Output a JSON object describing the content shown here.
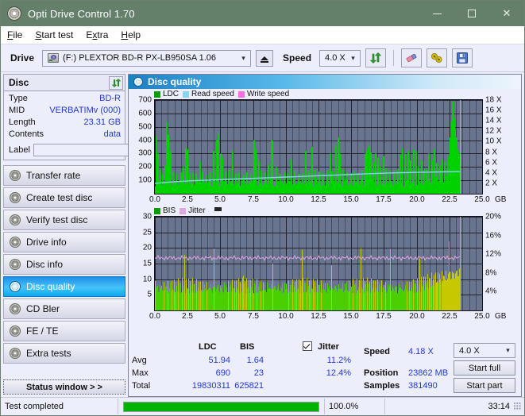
{
  "window": {
    "title": "Opti Drive Control 1.70",
    "icon": "disc-icon",
    "minimize": "minimize-icon",
    "maximize": "maximize-icon",
    "close": "close-icon"
  },
  "menu": [
    {
      "label": "File",
      "accel": "F"
    },
    {
      "label": "Start test",
      "accel": "S"
    },
    {
      "label": "Extra",
      "accel": "x"
    },
    {
      "label": "Help",
      "accel": "H"
    }
  ],
  "toolbar": {
    "drive_label": "Drive",
    "drive_value": "(F:)  PLEXTOR BD-R  PX-LB950SA 1.06",
    "eject": "eject-icon",
    "speed_label": "Speed",
    "speed_value": "4.0 X",
    "refresh": "refresh-icon",
    "eraser": "eraser-icon",
    "tools": "tools-icon",
    "save": "save-icon"
  },
  "disc": {
    "header": "Disc",
    "refresh": "refresh-icon",
    "rows": [
      {
        "key": "Type",
        "value": "BD-R"
      },
      {
        "key": "MID",
        "value": "VERBATIMv (000)"
      },
      {
        "key": "Length",
        "value": "23.31 GB"
      },
      {
        "key": "Contents",
        "value": "data"
      }
    ],
    "label_key": "Label",
    "label_value": "",
    "label_placeholder": "",
    "label_button": "disc-icon"
  },
  "sidebar": {
    "items": [
      {
        "label": "Transfer rate",
        "active": false
      },
      {
        "label": "Create test disc",
        "active": false
      },
      {
        "label": "Verify test disc",
        "active": false
      },
      {
        "label": "Drive info",
        "active": false
      },
      {
        "label": "Disc info",
        "active": false
      },
      {
        "label": "Disc quality",
        "active": true
      },
      {
        "label": "CD Bler",
        "active": false
      },
      {
        "label": "FE / TE",
        "active": false
      },
      {
        "label": "Extra tests",
        "active": false
      }
    ],
    "status_button": "Status window > >"
  },
  "panel": {
    "title": "Disc quality",
    "icon": "disc-quality-icon"
  },
  "chart_data": [
    {
      "type": "area",
      "title": "LDC / Read speed",
      "legend": [
        {
          "label": "LDC",
          "color": "#00a000"
        },
        {
          "label": "Read speed",
          "color": "#89d3f2"
        },
        {
          "label": "Write speed",
          "color": "#ff6ee0"
        }
      ],
      "legend_position": "top-left",
      "grid": true,
      "xlabel": "GB",
      "xlim": [
        0,
        25
      ],
      "xticks": [
        "0.0",
        "2.5",
        "5.0",
        "7.5",
        "10.0",
        "12.5",
        "15.0",
        "17.5",
        "20.0",
        "22.5",
        "25.0"
      ],
      "ylabel": "LDC",
      "ylim": [
        0,
        700
      ],
      "yticks": [
        100,
        200,
        300,
        400,
        500,
        600,
        700
      ],
      "y2label": "Speed",
      "y2lim": [
        0,
        18
      ],
      "y2ticks": [
        "2 X",
        "4 X",
        "6 X",
        "8 X",
        "10 X",
        "12 X",
        "14 X",
        "16 X",
        "18 X"
      ],
      "cursor_x": 23.31,
      "series": [
        {
          "name": "LDC",
          "color": "#00d200",
          "baseline": 55,
          "spikes": [
            [
              0.05,
              430
            ],
            [
              0.18,
              300
            ],
            [
              0.35,
              180
            ],
            [
              0.55,
              150
            ],
            [
              0.72,
              210
            ],
            [
              0.85,
              535
            ],
            [
              0.95,
              440
            ],
            [
              1.05,
              300
            ],
            [
              1.18,
              320
            ],
            [
              1.35,
              165
            ],
            [
              1.6,
              150
            ],
            [
              1.95,
              160
            ],
            [
              2.15,
              200
            ],
            [
              2.3,
              340
            ],
            [
              2.4,
              330
            ],
            [
              2.6,
              150
            ],
            [
              2.85,
              160
            ],
            [
              3.1,
              150
            ],
            [
              3.4,
              240
            ],
            [
              3.6,
              165
            ],
            [
              3.9,
              140
            ],
            [
              4.2,
              160
            ],
            [
              4.45,
              320
            ],
            [
              4.65,
              400
            ],
            [
              4.8,
              445
            ],
            [
              4.95,
              300
            ],
            [
              5.1,
              265
            ],
            [
              5.35,
              160
            ],
            [
              5.6,
              180
            ],
            [
              5.9,
              320
            ],
            [
              6.15,
              150
            ],
            [
              6.4,
              160
            ],
            [
              6.75,
              140
            ],
            [
              7.0,
              160
            ],
            [
              7.3,
              150
            ],
            [
              7.55,
              400
            ],
            [
              7.65,
              330
            ],
            [
              7.9,
              250
            ],
            [
              8.1,
              170
            ],
            [
              8.35,
              160
            ],
            [
              8.6,
              220
            ],
            [
              8.85,
              400
            ],
            [
              8.95,
              395
            ],
            [
              9.2,
              200
            ],
            [
              9.5,
              150
            ],
            [
              9.8,
              160
            ],
            [
              10.1,
              155
            ],
            [
              10.35,
              255
            ],
            [
              10.6,
              170
            ],
            [
              10.9,
              150
            ],
            [
              11.2,
              155
            ],
            [
              11.45,
              320
            ],
            [
              11.7,
              170
            ],
            [
              11.95,
              350
            ],
            [
              12.2,
              180
            ],
            [
              12.5,
              165
            ],
            [
              12.8,
              150
            ],
            [
              13.1,
              175
            ],
            [
              13.35,
              300
            ],
            [
              13.5,
              170
            ],
            [
              13.75,
              360
            ],
            [
              13.95,
              420
            ],
            [
              14.1,
              300
            ],
            [
              14.35,
              180
            ],
            [
              14.6,
              160
            ],
            [
              14.9,
              155
            ],
            [
              15.2,
              165
            ],
            [
              15.5,
              155
            ],
            [
              15.8,
              175
            ],
            [
              16.0,
              300
            ],
            [
              16.15,
              330
            ],
            [
              16.3,
              360
            ],
            [
              16.45,
              310
            ],
            [
              16.6,
              230
            ],
            [
              16.8,
              300
            ],
            [
              17.0,
              270
            ],
            [
              17.2,
              200
            ],
            [
              17.4,
              280
            ],
            [
              17.6,
              190
            ],
            [
              17.9,
              175
            ],
            [
              18.2,
              170
            ],
            [
              18.5,
              180
            ],
            [
              18.7,
              290
            ],
            [
              18.9,
              340
            ],
            [
              19.05,
              300
            ],
            [
              19.3,
              320
            ],
            [
              19.5,
              250
            ],
            [
              19.7,
              330
            ],
            [
              19.9,
              320
            ],
            [
              20.1,
              200
            ],
            [
              20.3,
              250
            ],
            [
              20.5,
              175
            ],
            [
              20.7,
              185
            ],
            [
              20.9,
              300
            ],
            [
              21.1,
              250
            ],
            [
              21.3,
              330
            ],
            [
              21.5,
              230
            ],
            [
              21.7,
              210
            ],
            [
              21.9,
              260
            ],
            [
              22.1,
              240
            ],
            [
              22.3,
              280
            ],
            [
              22.5,
              420
            ],
            [
              22.6,
              540
            ],
            [
              22.7,
              690
            ],
            [
              22.8,
              560
            ],
            [
              22.9,
              480
            ],
            [
              23.0,
              420
            ],
            [
              23.1,
              330
            ],
            [
              23.2,
              300
            ]
          ]
        },
        {
          "name": "Read speed",
          "color": "#89d3f2",
          "points": [
            [
              0.0,
              2.0
            ],
            [
              1.0,
              2.2
            ],
            [
              2.0,
              2.4
            ],
            [
              3.0,
              2.5
            ],
            [
              4.0,
              2.6
            ],
            [
              5.0,
              2.7
            ],
            [
              6.0,
              2.8
            ],
            [
              7.0,
              2.9
            ],
            [
              8.0,
              3.0
            ],
            [
              9.0,
              3.1
            ],
            [
              10.0,
              3.2
            ],
            [
              11.0,
              3.3
            ],
            [
              12.0,
              3.4
            ],
            [
              13.0,
              3.5
            ],
            [
              14.0,
              3.6
            ],
            [
              15.0,
              3.7
            ],
            [
              16.0,
              3.8
            ],
            [
              17.0,
              3.9
            ],
            [
              18.0,
              4.0
            ],
            [
              19.0,
              4.05
            ],
            [
              20.0,
              4.1
            ],
            [
              21.0,
              4.15
            ],
            [
              22.0,
              4.2
            ],
            [
              23.3,
              4.25
            ]
          ]
        }
      ]
    },
    {
      "type": "area",
      "title": "BIS / Jitter",
      "legend": [
        {
          "label": "BIS",
          "color": "#00a000"
        },
        {
          "label": "Jitter",
          "color": "#e0a8e0"
        },
        {
          "label": "",
          "color": "#242424"
        }
      ],
      "legend_position": "top-left",
      "grid": true,
      "xlabel": "GB",
      "xlim": [
        0,
        25
      ],
      "xticks": [
        "0.0",
        "2.5",
        "5.0",
        "7.5",
        "10.0",
        "12.5",
        "15.0",
        "17.5",
        "20.0",
        "22.5",
        "25.0"
      ],
      "ylabel": "BIS",
      "ylim": [
        0,
        30
      ],
      "yticks": [
        5,
        10,
        15,
        20,
        25,
        30
      ],
      "y2label": "Jitter",
      "y2lim": [
        0,
        20
      ],
      "y2ticks": [
        "4%",
        "8%",
        "12%",
        "16%",
        "20%"
      ],
      "cursor_x": 23.31,
      "series": [
        {
          "name": "BIS",
          "color": "#4ad000",
          "baseline": 5.5,
          "noise": 2.5,
          "tail_color": "#c8c800"
        },
        {
          "name": "Jitter",
          "color": "#e0a8e0",
          "level": 11.2,
          "max": 12.4
        }
      ]
    }
  ],
  "stats": {
    "col_headers": [
      "LDC",
      "BIS"
    ],
    "jitter_header": "Jitter",
    "jitter_checked": true,
    "rows": [
      {
        "label": "Avg",
        "ldc": "51.94",
        "bis": "1.64",
        "jitter": "11.2%"
      },
      {
        "label": "Max",
        "ldc": "690",
        "bis": "23",
        "jitter": "12.4%"
      },
      {
        "label": "Total",
        "ldc": "19830311",
        "bis": "625821",
        "jitter": ""
      }
    ],
    "speed_label": "Speed",
    "speed_value": "4.18 X",
    "position_label": "Position",
    "position_value": "23862 MB",
    "samples_label": "Samples",
    "samples_value": "381490",
    "speed_select": "4.0 X",
    "start_full": "Start full",
    "start_part": "Start part"
  },
  "statusbar": {
    "message": "Test completed",
    "progress_percent": 100,
    "progress_text": "100.0%",
    "elapsed": "33:14"
  }
}
